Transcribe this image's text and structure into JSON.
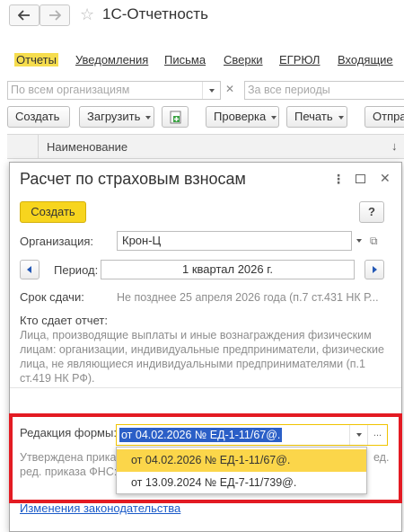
{
  "app": {
    "title": "1С-Отчетность"
  },
  "tabs": [
    "Отчеты",
    "Уведомления",
    "Письма",
    "Сверки",
    "ЕГРЮЛ",
    "Входящие"
  ],
  "filters": {
    "organizations_placeholder": "По всем организациям",
    "periods_placeholder": "За все периоды"
  },
  "toolbar": {
    "create": "Создать",
    "load": "Загрузить",
    "check": "Проверка",
    "print": "Печать",
    "send_partial": "Отпра"
  },
  "table": {
    "column_name": "Наименование",
    "sort_icon": "↓"
  },
  "dialog": {
    "title": "Расчет по страховым взносам",
    "create_button": "Создать",
    "help_button": "?",
    "organization_label": "Организация:",
    "organization_value": "Крон-Ц",
    "period_label": "Период:",
    "period_value": "1 квартал 2026 г.",
    "deadline_label": "Срок сдачи:",
    "deadline_value": "Не позднее 25 апреля 2026 года (п.7 ст.431 НК Р...",
    "who_label": "Кто сдает отчет:",
    "who_text": "Лица, производящие выплаты и иные вознаграждения физическим лицам: организации, индивидуальные предприниматели, физические лица, не являющиеся индивидуальными предпринимателями (п.1 ст.419 НК РФ).",
    "form_edition_label": "Редакция формы:",
    "form_edition_value": "от 04.02.2026 № ЕД-1-11/67@.",
    "approved_line1": "Утверждена прика",
    "approved_line2": "ред. приказа ФНС:",
    "approved_suffix": "ед.",
    "dropdown_options": [
      "от 04.02.2026 № ЕД-1-11/67@.",
      "от 13.09.2024 № ЕД-7-11/739@."
    ],
    "law_changes_link": "Изменения законодательства"
  },
  "colors": {
    "accent_yellow": "#f7d51e",
    "highlight_red": "#e31b23",
    "selection_blue": "#2b5fc7",
    "link_blue": "#1a5ac8"
  }
}
